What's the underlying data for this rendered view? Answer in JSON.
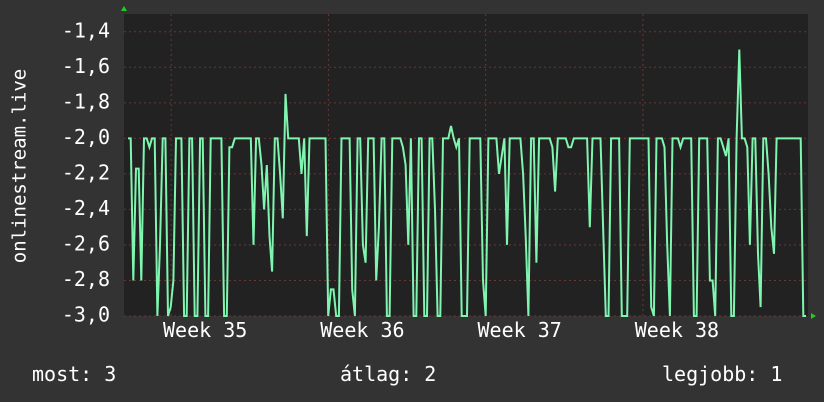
{
  "colors": {
    "background": "#333333",
    "plot_background": "#222222",
    "grid": "#6b3535",
    "series": "#7ff5b0",
    "axis_arrow": "#22cc22"
  },
  "chart_data": {
    "type": "line",
    "ylabel": "onlinestream.live",
    "ylim": [
      -3.0,
      -1.3
    ],
    "yticks": [
      "-1,4",
      "-1,6",
      "-1,8",
      "-2,0",
      "-2,2",
      "-2,4",
      "-2,6",
      "-2,8",
      "-3,0"
    ],
    "ytick_values": [
      -1.4,
      -1.6,
      -1.8,
      -2.0,
      -2.2,
      -2.4,
      -2.6,
      -2.8,
      -3.0
    ],
    "xticks": [
      "Week 35",
      "Week 36",
      "Week 37",
      "Week 38"
    ],
    "xlim": [
      34.3,
      38.65
    ],
    "xtick_values": [
      34.6,
      35.6,
      36.6,
      37.6
    ],
    "grid": true,
    "series": [
      {
        "values": [
          -2.0,
          -2.0,
          -2.8,
          -2.17,
          -2.17,
          -2.8,
          -2.0,
          -2.0,
          -2.05,
          -2.0,
          -2.0,
          -3.0,
          -2.6,
          -2.0,
          -2.0,
          -3.0,
          -2.95,
          -2.8,
          -2.0,
          -2.0,
          -2.0,
          -3.0,
          -3.0,
          -2.0,
          -2.0,
          -3.0,
          -3.0,
          -2.0,
          -2.0,
          -3.0,
          -3.0,
          -2.0,
          -2.0,
          -2.0,
          -2.0,
          -2.0,
          -3.0,
          -3.0,
          -2.05,
          -2.05,
          -2.0,
          -2.0,
          -2.0,
          -2.0,
          -2.0,
          -2.0,
          -2.0,
          -2.6,
          -2.0,
          -2.0,
          -2.15,
          -2.4,
          -2.15,
          -2.55,
          -2.75,
          -2.0,
          -2.0,
          -2.2,
          -2.45,
          -1.75,
          -2.0,
          -2.0,
          -2.0,
          -2.0,
          -2.0,
          -2.2,
          -2.0,
          -2.55,
          -2.0,
          -2.0,
          -2.0,
          -2.0,
          -2.0,
          -2.0,
          -2.0,
          -3.0,
          -2.85,
          -2.85,
          -3.0,
          -3.0,
          -2.0,
          -2.0,
          -2.0,
          -2.0,
          -2.85,
          -3.0,
          -2.0,
          -2.0,
          -2.6,
          -2.7,
          -2.0,
          -2.0,
          -2.0,
          -2.8,
          -2.5,
          -2.0,
          -2.0,
          -3.0,
          -3.0,
          -2.0,
          -2.0,
          -2.0,
          -2.0,
          -2.05,
          -2.15,
          -2.6,
          -2.0,
          -3.0,
          -3.0,
          -2.0,
          -2.0,
          -3.0,
          -3.0,
          -2.0,
          -2.0,
          -2.4,
          -3.0,
          -3.0,
          -2.0,
          -2.0,
          -2.0,
          -1.93,
          -2.0,
          -2.05,
          -2.0,
          -3.0,
          -3.0,
          -3.0,
          -2.0,
          -2.0,
          -2.0,
          -2.0,
          -2.0,
          -2.8,
          -3.0,
          -2.0,
          -2.0,
          -2.0,
          -2.0,
          -2.2,
          -2.1,
          -2.0,
          -2.6,
          -2.0,
          -2.0,
          -2.0,
          -2.0,
          -2.0,
          -2.2,
          -2.55,
          -3.0,
          -2.0,
          -2.0,
          -2.7,
          -2.0,
          -2.0,
          -2.0,
          -2.0,
          -2.0,
          -2.05,
          -2.3,
          -2.0,
          -2.0,
          -2.0,
          -2.0,
          -2.05,
          -2.05,
          -2.0,
          -2.0,
          -2.0,
          -2.0,
          -2.0,
          -2.0,
          -2.5,
          -2.0,
          -2.0,
          -2.0,
          -2.0,
          -2.5,
          -3.0,
          -3.0,
          -2.0,
          -2.0,
          -2.0,
          -2.0,
          -3.0,
          -3.0,
          -3.0,
          -2.0,
          -2.0,
          -2.0,
          -2.0,
          -2.0,
          -2.0,
          -2.0,
          -2.0,
          -2.95,
          -3.0,
          -2.0,
          -2.0,
          -2.0,
          -2.05,
          -2.6,
          -3.0,
          -2.0,
          -2.0,
          -2.0,
          -2.05,
          -2.0,
          -2.0,
          -2.0,
          -2.0,
          -3.0,
          -3.0,
          -2.0,
          -2.0,
          -2.0,
          -2.0,
          -2.8,
          -2.8,
          -3.0,
          -2.0,
          -2.0,
          -2.05,
          -2.1,
          -2.0,
          -3.0,
          -3.0,
          -2.0,
          -1.5,
          -2.0,
          -2.0,
          -2.05,
          -2.6,
          -2.0,
          -2.0,
          -2.65,
          -2.95,
          -2.0,
          -2.0,
          -2.2,
          -2.5,
          -2.65,
          -2.0,
          -2.0,
          -2.0,
          -2.0,
          -2.0,
          -2.0,
          -2.0,
          -2.0,
          -2.0,
          -2.0,
          -3.0,
          -3.0
        ]
      }
    ]
  },
  "footer": {
    "current": "most: 3",
    "average": "átlag: 2",
    "best": "legjobb: 1"
  }
}
